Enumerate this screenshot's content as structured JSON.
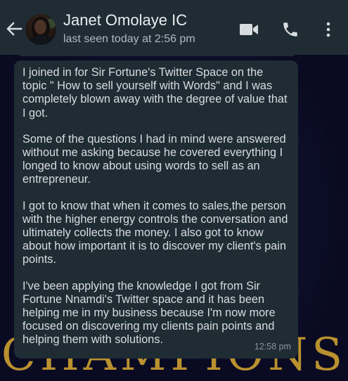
{
  "header": {
    "contact_name": "Janet Omolaye IC",
    "status": "last seen today at 2:56 pm",
    "back_icon": "arrow-left-icon",
    "video_icon": "video-camera-icon",
    "call_icon": "phone-icon",
    "menu_icon": "more-vertical-icon"
  },
  "background": {
    "wordmark": "CHAMPIONS"
  },
  "message": {
    "paragraphs": [
      "I joined in for Sir Fortune's Twitter Space on the topic \" How to sell yourself with Words\" and I was completely blown away with the degree of value that I got.",
      "Some of the questions I had in mind were answered without me asking because he covered everything I longed to know about using words to sell as an entrepreneur.",
      "I got to know that when it comes to sales,the person with the higher energy controls the conversation and ultimately collects the money. I also got to know about how important it is to discover my client's pain points.",
      "I've been applying the knowledge I got from Sir Fortune Nnamdi's Twitter space and it has been helping me in my business because I'm now more focused on discovering my clients pain points and helping them with solutions."
    ],
    "time": "12:58 pm"
  },
  "colors": {
    "header_bg": "#1f2c34",
    "bubble_bg": "#1f2c34",
    "chat_bg": "#0a0b22",
    "wordmark_gold": "#b9912e",
    "text_primary": "#e9edef",
    "text_secondary": "#aebac1"
  }
}
